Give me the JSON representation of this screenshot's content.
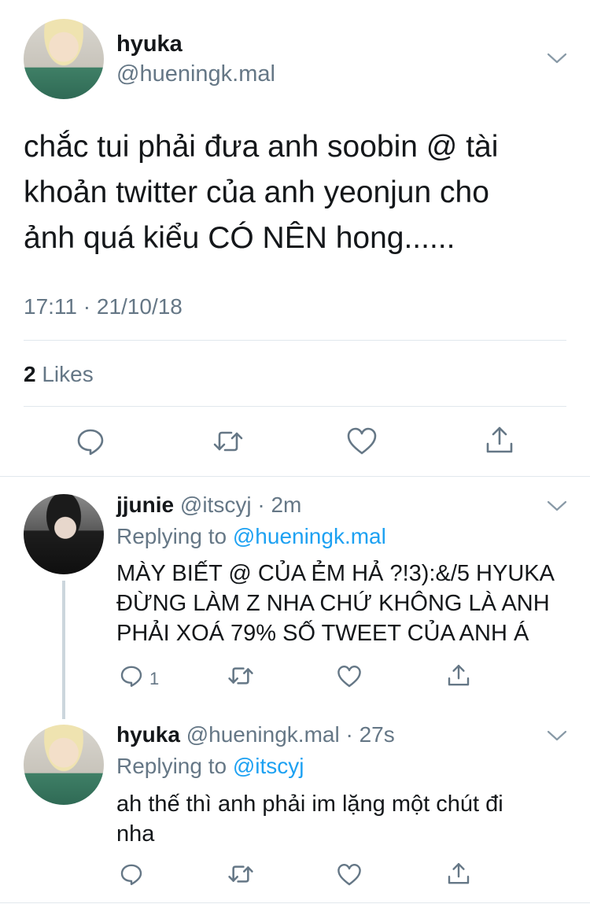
{
  "main_tweet": {
    "display_name": "hyuka",
    "handle": "@hueningk.mal",
    "text_lines": [
      "chắc tui phải đưa anh soobin @ tài",
      "khoản twitter của anh yeonjun cho",
      "ảnh quá kiểu CÓ NÊN hong......"
    ],
    "timestamp": "17:11 · 21/10/18",
    "likes_count": "2",
    "likes_label": "Likes"
  },
  "replies": [
    {
      "display_name": "jjunie",
      "handle": "@itscyj",
      "time": "· 2m",
      "replying_prefix": "Replying to",
      "replying_to": "@hueningk.mal",
      "text_lines": [
        "MÀY BIẾT @ CỦA ẺM HẢ ?!3):&/5 HYUKA",
        "ĐỪNG LÀM Z NHA CHỨ KHÔNG LÀ ANH",
        "PHẢI XOÁ 79% SỐ TWEET CỦA ANH Á"
      ],
      "reply_count": "1"
    },
    {
      "display_name": "hyuka",
      "handle": "@hueningk.mal",
      "time": "· 27s",
      "replying_prefix": "Replying to",
      "replying_to": "@itscyj",
      "text_lines": [
        "ah thế thì anh phải im lặng một chút đi",
        "nha"
      ]
    }
  ],
  "colors": {
    "text": "#14171a",
    "muted": "#657786",
    "link": "#1da1f2",
    "divider": "#e1e8ed"
  }
}
